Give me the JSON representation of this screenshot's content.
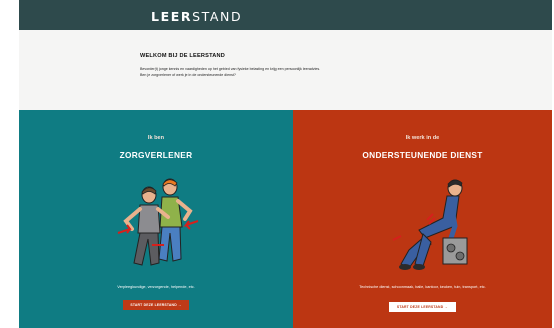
{
  "header": {
    "logo_bold": "LEER",
    "logo_light": "STAND"
  },
  "intro": {
    "title": "WELKOM BIJ DE LEERSTAND",
    "line1": "Bevorder(t) jonge kennis en vaardigheden op het gebied van fysieke belasting en krijg een persoonlijk leeradvies.",
    "line2": "Ben je zorgverlener of werk je in de ondersteunende dienst?"
  },
  "panels": {
    "care": {
      "kicker": "Ik ben",
      "heading": "ZORGVERLENER",
      "caption": "Verpleegkundige, verzorgende, helpende, etc.",
      "cta": "START DEZE LEERSTAND →",
      "color": "#0f7c83",
      "illustration": "two-caregivers-illustration"
    },
    "support": {
      "kicker": "Ik werk in de",
      "heading": "ONDERSTEUNENDE DIENST",
      "caption": "Technische dienst, schoonmaak, balie, kantoor, keuken, tuin, transport, etc.",
      "cta": "START DEZE LEERSTAND →",
      "color": "#bc3612",
      "illustration": "kneeling-worker-illustration"
    }
  }
}
